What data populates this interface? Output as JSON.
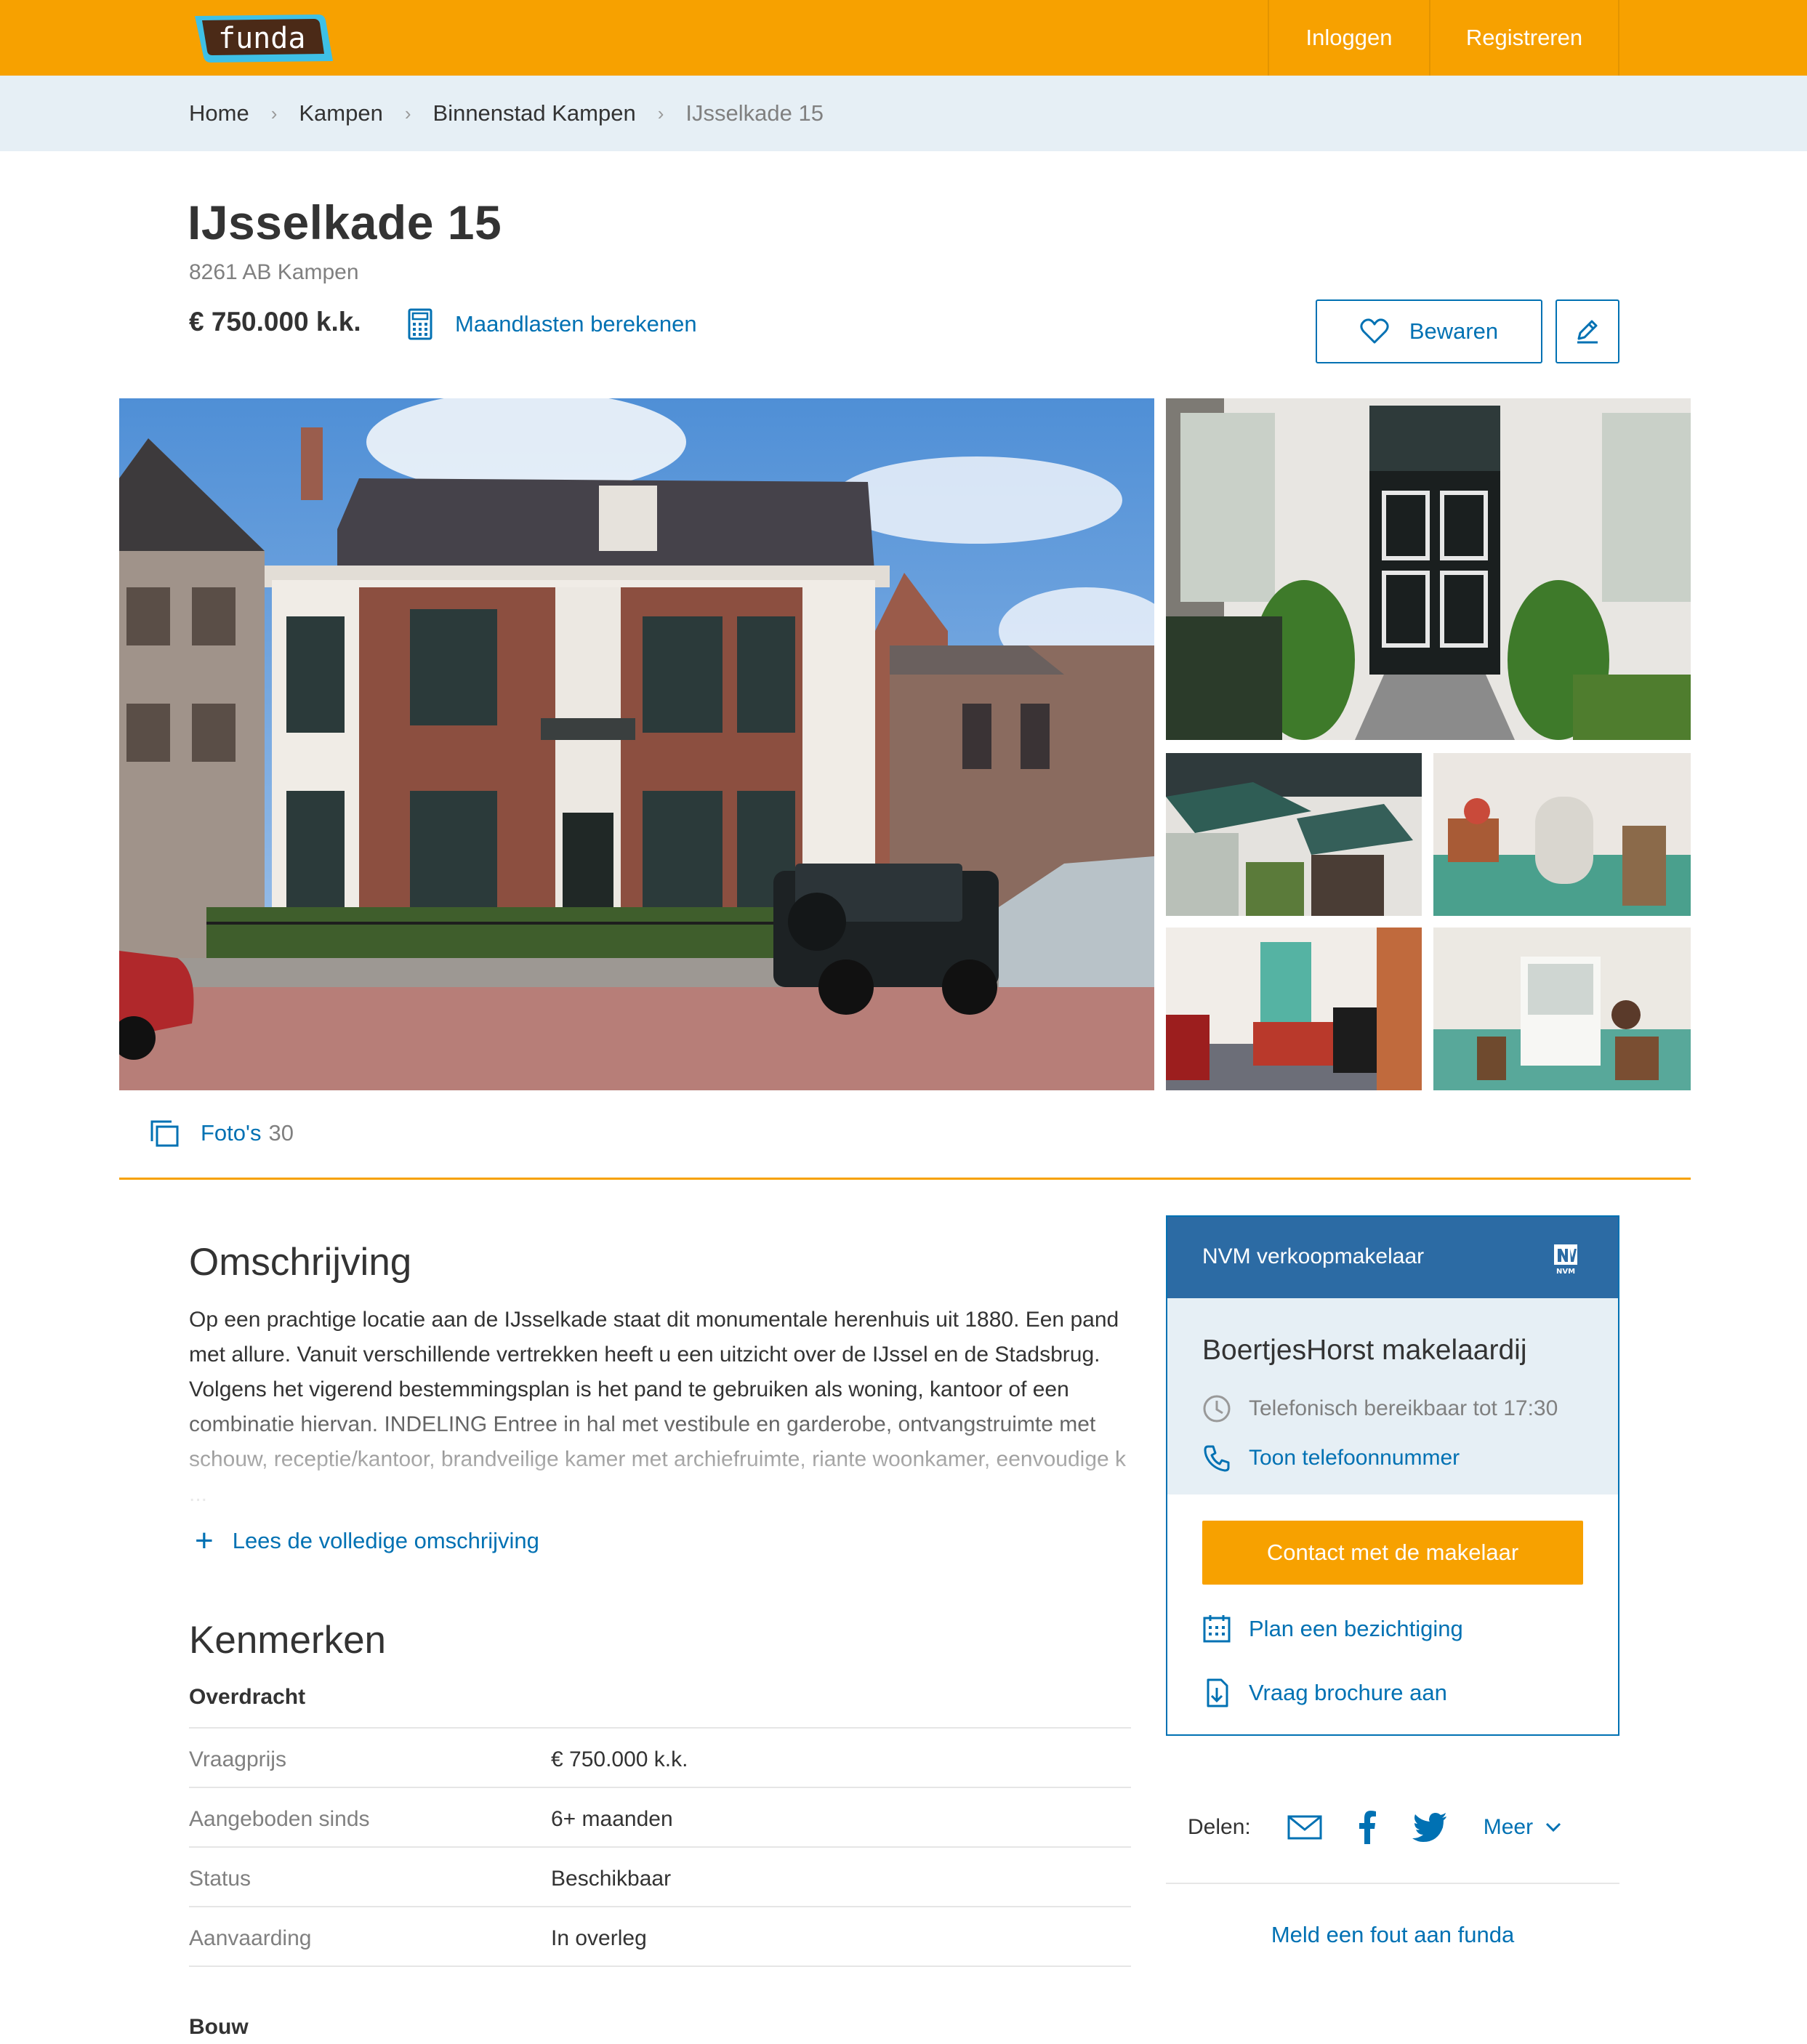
{
  "brand": {
    "logo_text": "funda",
    "colors": {
      "primary": "#f7a100",
      "link": "#0071b3",
      "card_header": "#2c6ba4",
      "breadcrumb_bg": "#e6eff5"
    }
  },
  "header": {
    "login_label": "Inloggen",
    "register_label": "Registreren"
  },
  "breadcrumb": {
    "items": [
      "Home",
      "Kampen",
      "Binnenstad Kampen"
    ],
    "current": "IJsselkade 15",
    "separator": "›"
  },
  "listing": {
    "title": "IJsselkade 15",
    "address": "8261 AB Kampen",
    "price": "€ 750.000 k.k.",
    "calc_link": "Maandlasten berekenen",
    "save_label": "Bewaren",
    "icons": {
      "calculator": "calculator-icon",
      "heart": "heart-icon",
      "edit": "pencil-icon"
    }
  },
  "photos": {
    "label": "Foto's",
    "count": "30",
    "icon": "gallery-icon"
  },
  "description": {
    "heading": "Omschrijving",
    "text": "Op een prachtige locatie aan de IJsselkade staat dit monumentale herenhuis uit 1880. Een pand met allure. Vanuit verschillende vertrekken heeft u een uitzicht over de IJssel en de Stadsbrug. Volgens het vigerend bestemmingsplan is het pand te gebruiken als woning, kantoor of een combinatie hiervan. INDELING Entree in hal met vestibule en garderobe, ontvangstruimte met schouw, receptie/kantoor, brandveilige kamer met archiefruimte, riante woonkamer, eenvoudige k ...",
    "read_more": "Lees de volledige omschrijving"
  },
  "features": {
    "heading": "Kenmerken",
    "groups": [
      {
        "title": "Overdracht",
        "rows": [
          {
            "key": "Vraagprijs",
            "value": "€ 750.000 k.k."
          },
          {
            "key": "Aangeboden sinds",
            "value": "6+ maanden"
          },
          {
            "key": "Status",
            "value": "Beschikbaar"
          },
          {
            "key": "Aanvaarding",
            "value": "In overleg"
          }
        ]
      },
      {
        "title": "Bouw"
      }
    ]
  },
  "agent": {
    "header": "NVM verkoopmakelaar",
    "nvm_badge": "NVM",
    "name": "BoertjesHorst makelaardij",
    "hours": "Telefonisch bereikbaar tot 17:30",
    "phone_link": "Toon telefoonnummer",
    "contact_button": "Contact met de makelaar",
    "plan_link": "Plan een bezichtiging",
    "brochure_link": "Vraag brochure aan"
  },
  "share": {
    "label": "Delen:",
    "more": "Meer",
    "icons": [
      "mail-icon",
      "facebook-icon",
      "twitter-icon"
    ]
  },
  "report_link": "Meld een fout aan funda"
}
